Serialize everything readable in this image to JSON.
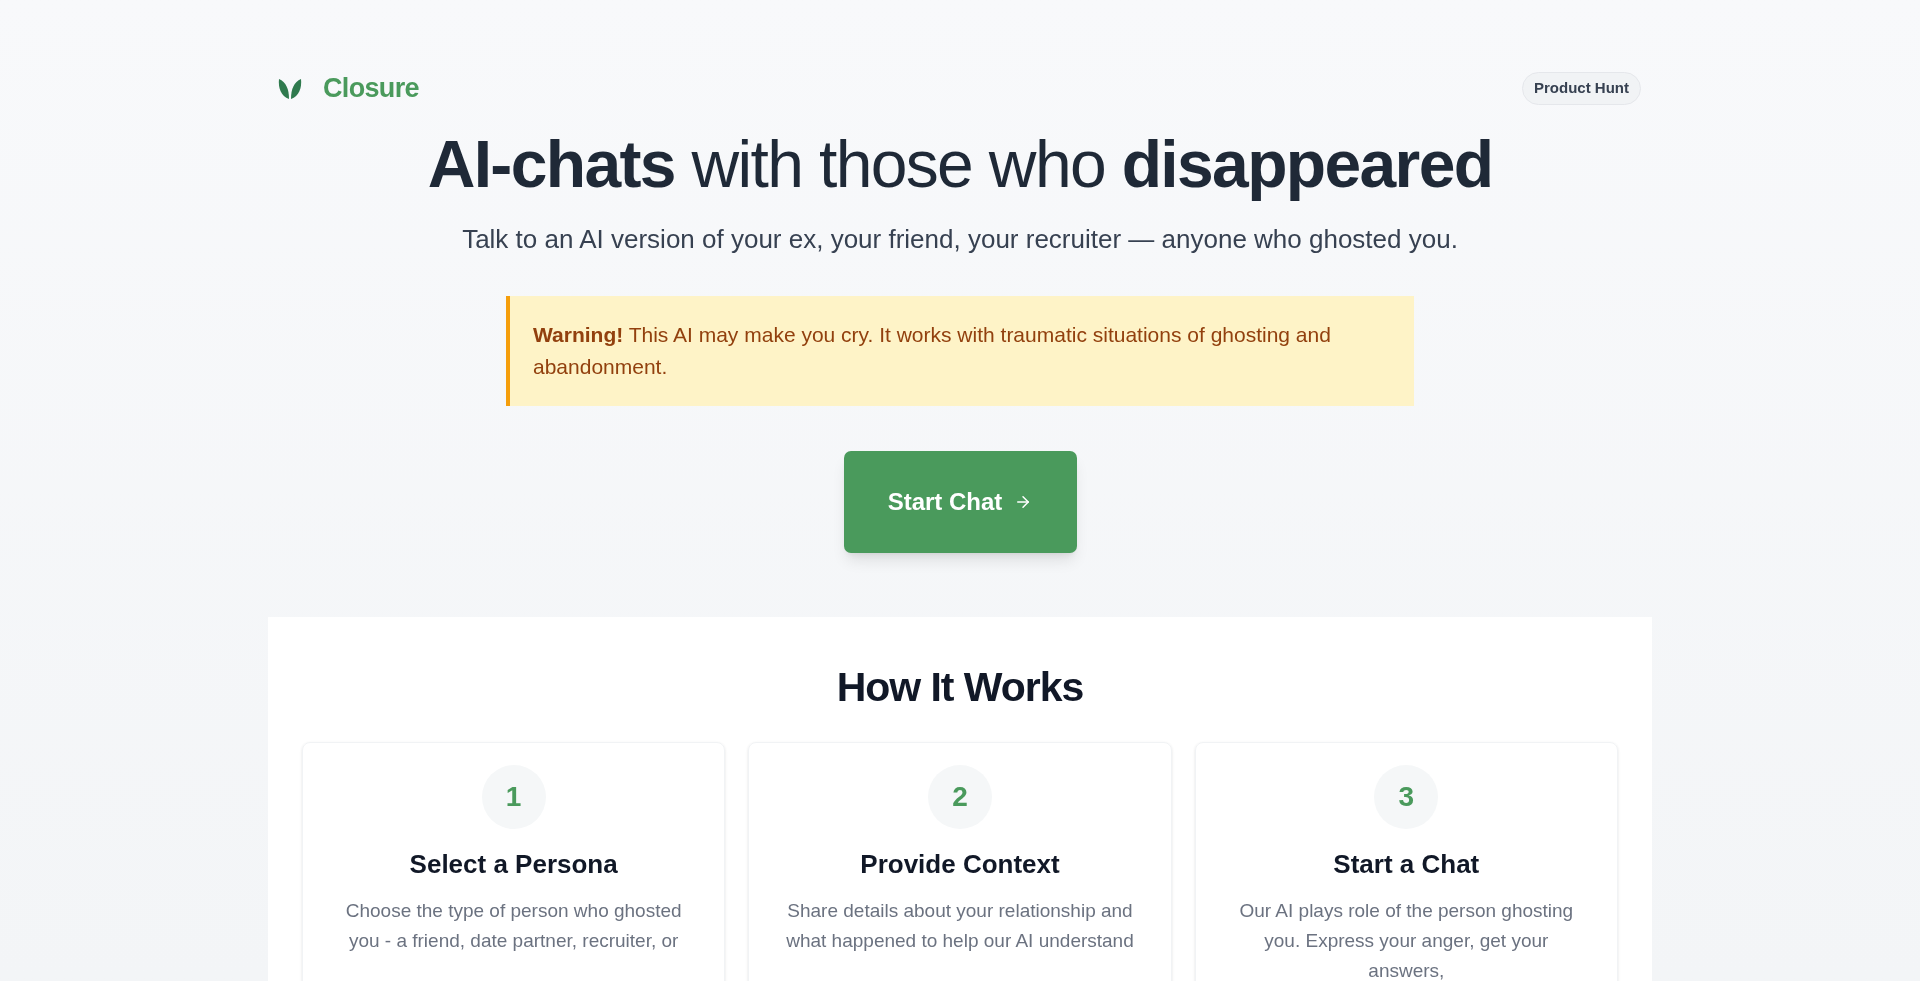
{
  "header": {
    "brand": "Closure",
    "product_hunt": "Product Hunt"
  },
  "hero": {
    "headline": "**AI-chats** with those who **disappeared**",
    "subtitle": "Talk to an AI version of your ex, your friend, your recruiter — anyone who ghosted you.",
    "warning": "**Warning!** This AI may make you cry. It works with traumatic situations of ghosting and abandonment.",
    "cta": "Start Chat"
  },
  "how_it_works": {
    "title": "How It Works",
    "steps": [
      {
        "number": "1",
        "title": "Select a Persona",
        "description": "Choose the type of person who ghosted you - a friend, date partner, recruiter, or"
      },
      {
        "number": "2",
        "title": "Provide Context",
        "description": "Share details about your relationship and what happened to help our AI understand"
      },
      {
        "number": "3",
        "title": "Start a Chat",
        "description": "Our AI plays role of the person ghosting you. Express your anger, get your answers,"
      }
    ]
  }
}
